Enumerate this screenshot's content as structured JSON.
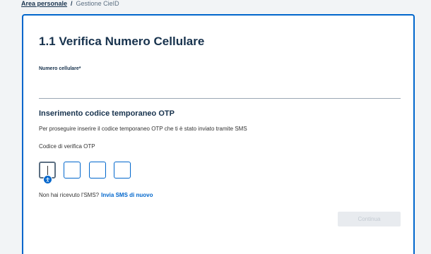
{
  "breadcrumb": {
    "items": [
      "Area personale",
      "Gestione CieID"
    ],
    "separator": "/"
  },
  "form": {
    "title": "1.1 Verifica Numero Cellulare",
    "phone_label": "Numero cellulare*",
    "phone_value": ""
  },
  "otp": {
    "heading": "Inserimento codice temporaneo OTP",
    "description": "Per proseguire inserire il codice temporaneo OTP che ti è stato inviato tramite SMS",
    "code_label": "Codice di verifica OTP",
    "digits": [
      "",
      "",
      "",
      ""
    ],
    "resend_text": "Non hai ricevuto l'SMS?",
    "resend_link": "Invia SMS di nuovo"
  },
  "actions": {
    "continue_label": "Continua"
  },
  "colors": {
    "accent": "#0066cc",
    "title": "#17324d",
    "disabled_bg": "#e8ebef"
  },
  "icons": [
    "accessibility-icon"
  ]
}
